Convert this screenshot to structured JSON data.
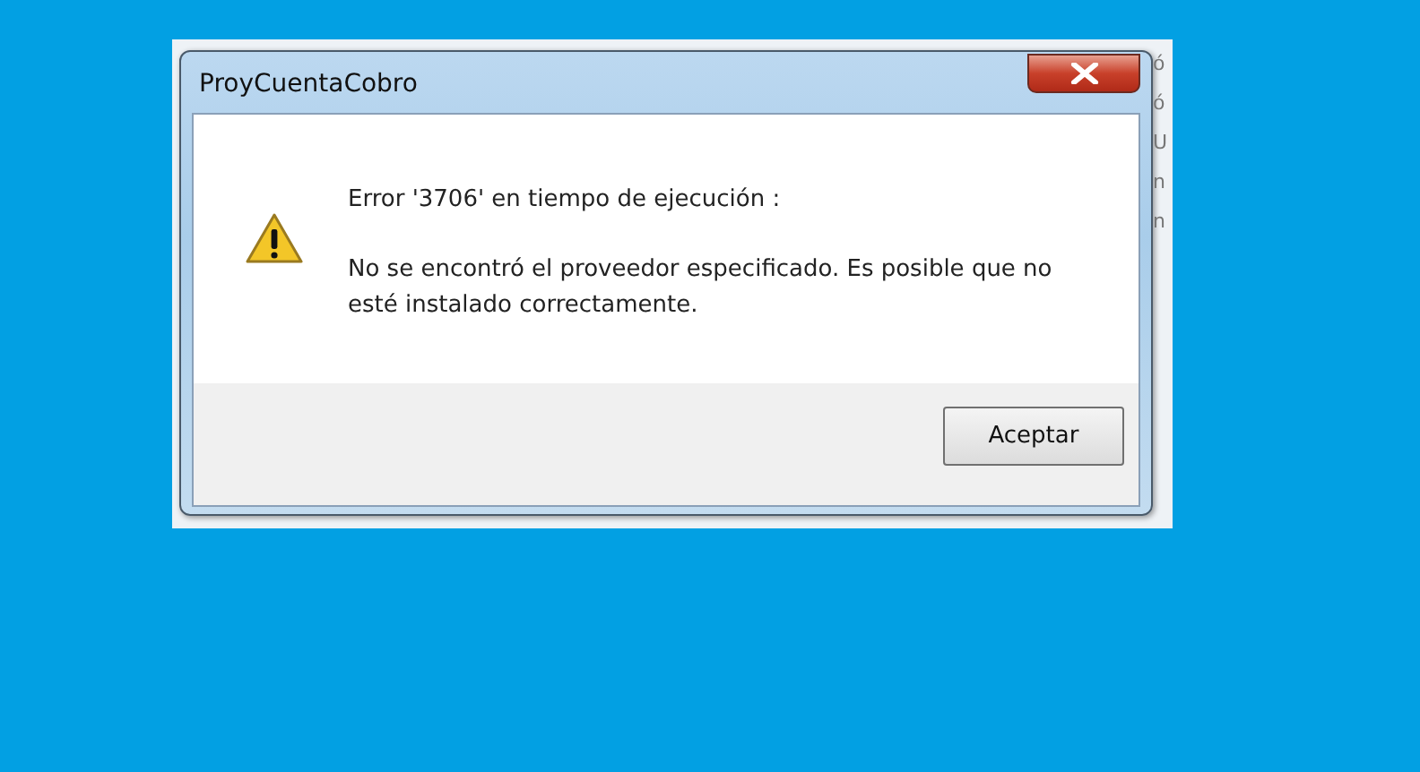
{
  "window": {
    "title": "ProyCuentaCobro"
  },
  "message": {
    "heading": "Error '3706' en tiempo de ejecución :",
    "body": "No se encontró el proveedor especificado. Es posible que no esté instalado correctamente."
  },
  "buttons": [
    "Aceptar"
  ],
  "background_fragments": [
    "ó",
    "ó",
    "U",
    "n",
    "n"
  ]
}
